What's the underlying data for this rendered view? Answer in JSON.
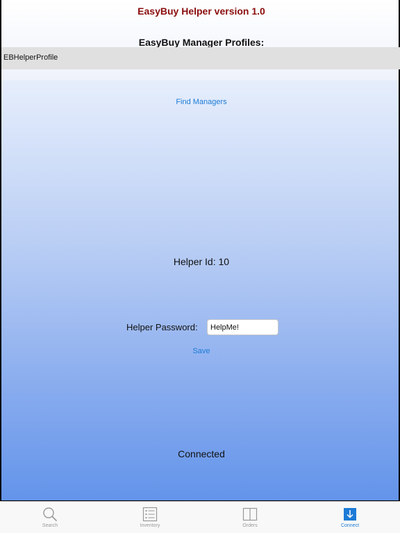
{
  "header": {
    "title": "EasyBuy Helper version 1.0",
    "profiles_heading": "EasyBuy Manager Profiles:"
  },
  "profiles": [
    {
      "name": "EBHelperProfile"
    }
  ],
  "main": {
    "find_managers_label": "Find Managers",
    "helper_id_text": "Helper Id: 10",
    "password_label": "Helper Password:",
    "password_value": "HelpMe!",
    "save_label": "Save",
    "status_text": "Connected"
  },
  "tabs": [
    {
      "label": "Search",
      "icon": "search-icon",
      "active": false
    },
    {
      "label": "Inventory",
      "icon": "list-icon",
      "active": false
    },
    {
      "label": "Orders",
      "icon": "book-icon",
      "active": false
    },
    {
      "label": "Connect",
      "icon": "download-icon",
      "active": true
    }
  ],
  "colors": {
    "title": "#8b0d0d",
    "link": "#1c7bd6",
    "tab_inactive": "#999999",
    "tab_active": "#1c7bd6"
  }
}
